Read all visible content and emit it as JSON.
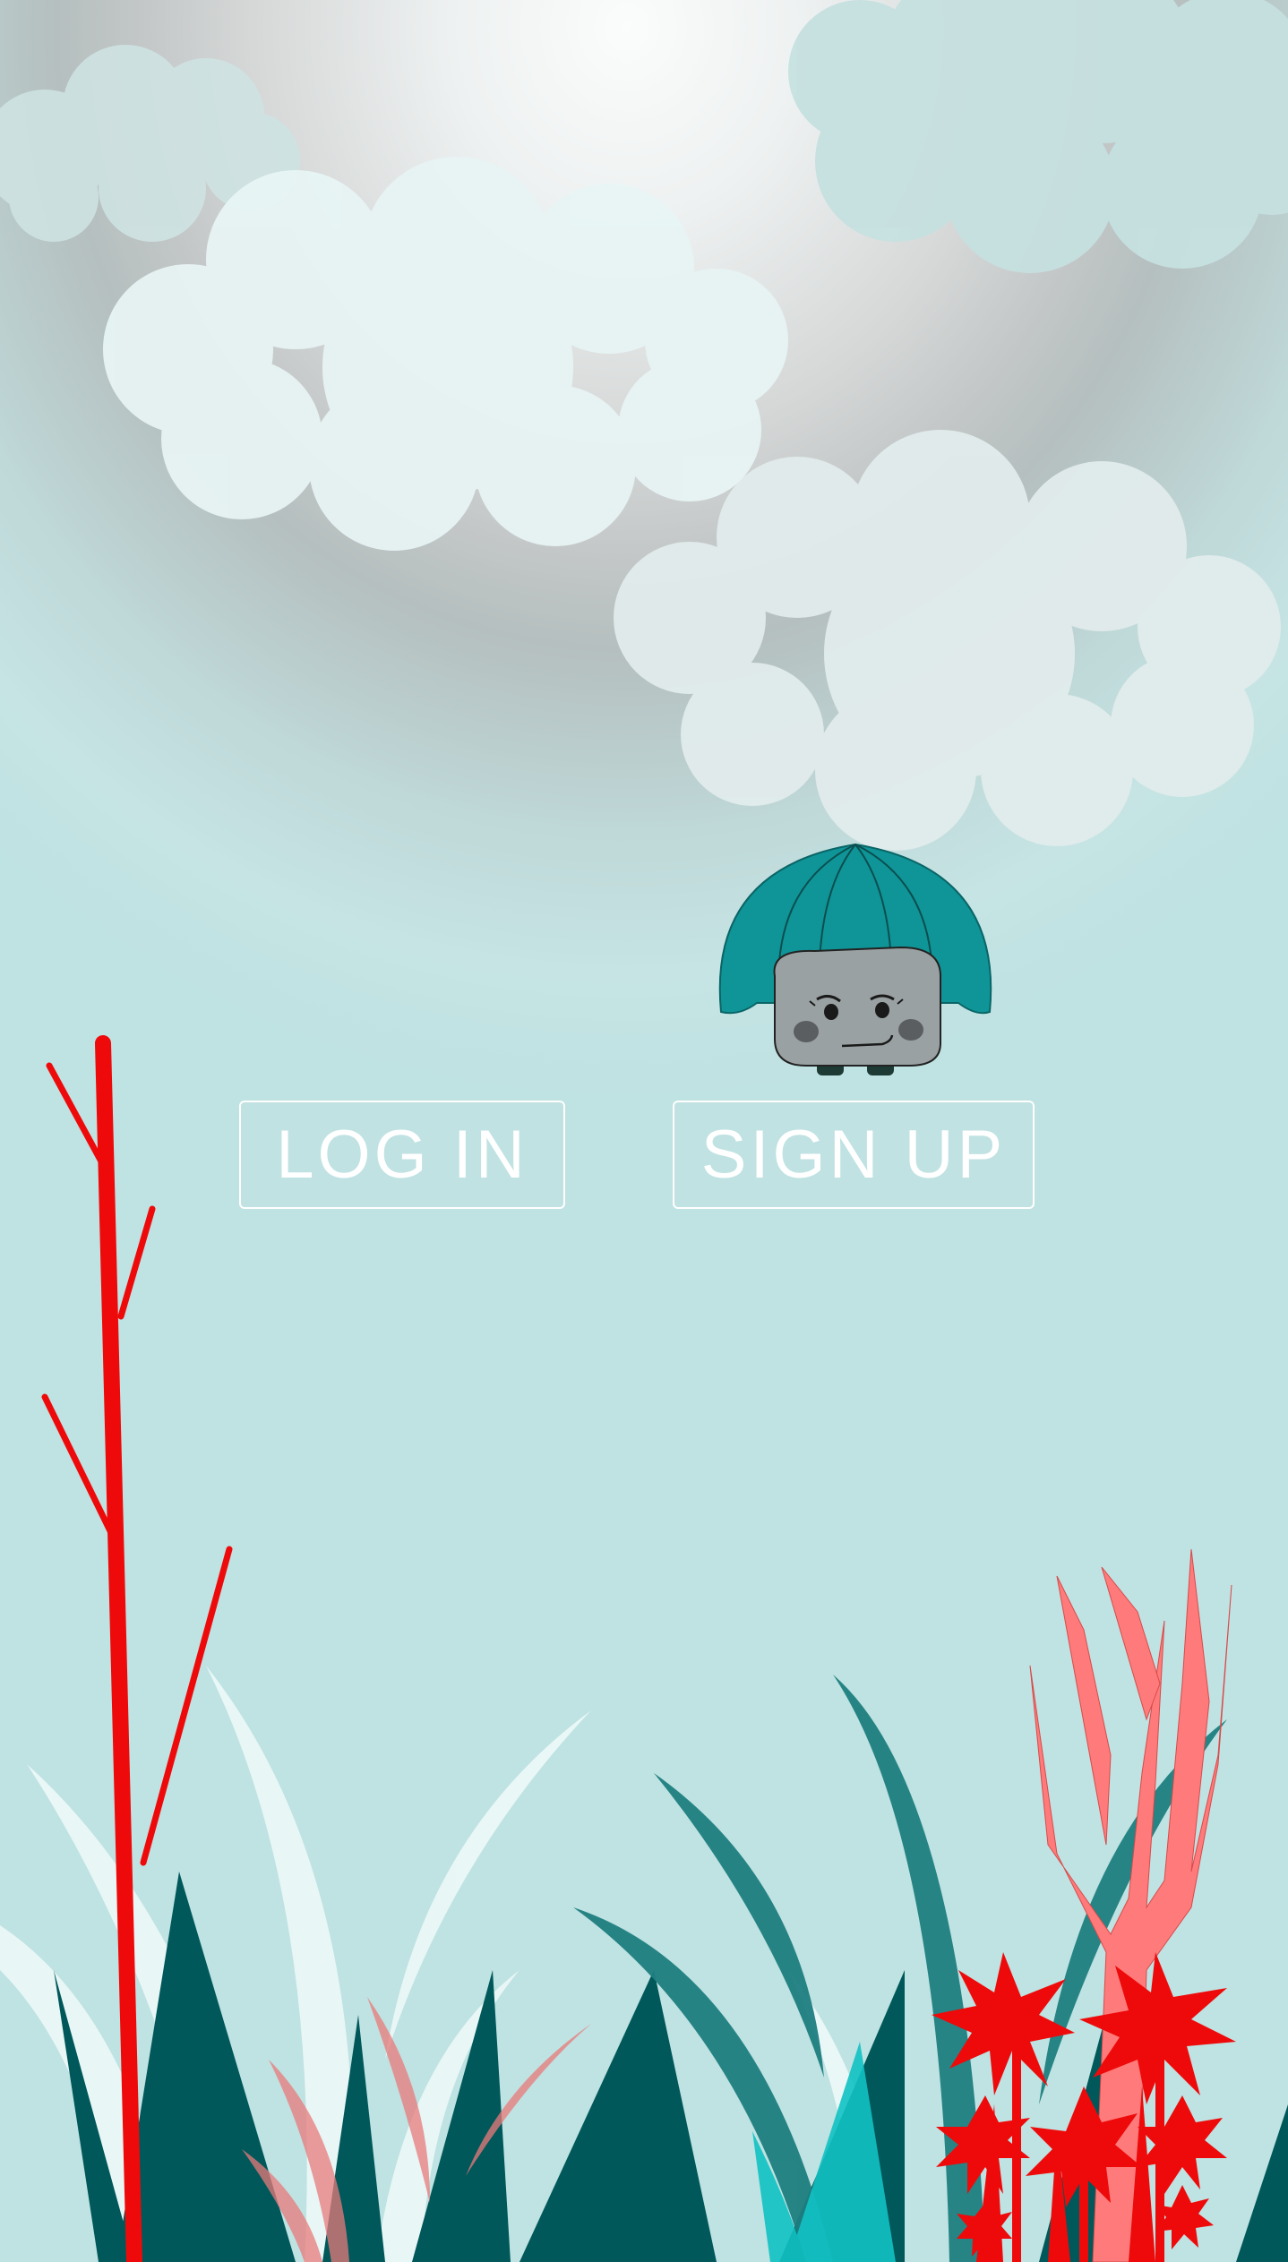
{
  "auth": {
    "login_label": "LOG IN",
    "signup_label": "SIGN UP"
  },
  "mascot": {
    "icon": "mushroom-mascot-icon"
  },
  "colors": {
    "teal_dark": "#00585a",
    "teal_cap": "#0f9597",
    "red_branch": "#ee0a0a",
    "coral": "#ff7b7b",
    "cloud": "#e6f3f3"
  }
}
